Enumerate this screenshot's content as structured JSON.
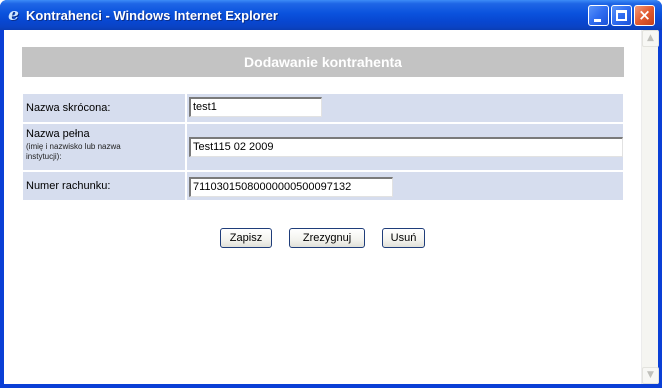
{
  "window": {
    "title": "Kontrahenci - Windows Internet Explorer",
    "controls": {
      "minimize": "minimize-icon",
      "maximize": "maximize-icon",
      "close": "×"
    }
  },
  "page": {
    "header": "Dodawanie kontrahenta"
  },
  "form": {
    "short_name": {
      "label": "Nazwa skrócona:",
      "value": "test1"
    },
    "full_name": {
      "label": "Nazwa pełna",
      "hint_line1": "(imię i nazwisko lub nazwa",
      "hint_line2": "instytucji):",
      "value": "Test115 02 2009"
    },
    "account_number": {
      "label": "Numer rachunku:",
      "value": "71103015080000000500097132"
    }
  },
  "buttons": {
    "save": "Zapisz",
    "cancel": "Zrezygnuj",
    "delete": "Usuń"
  },
  "scrollbar": {
    "up": "▲",
    "down": "▼"
  }
}
